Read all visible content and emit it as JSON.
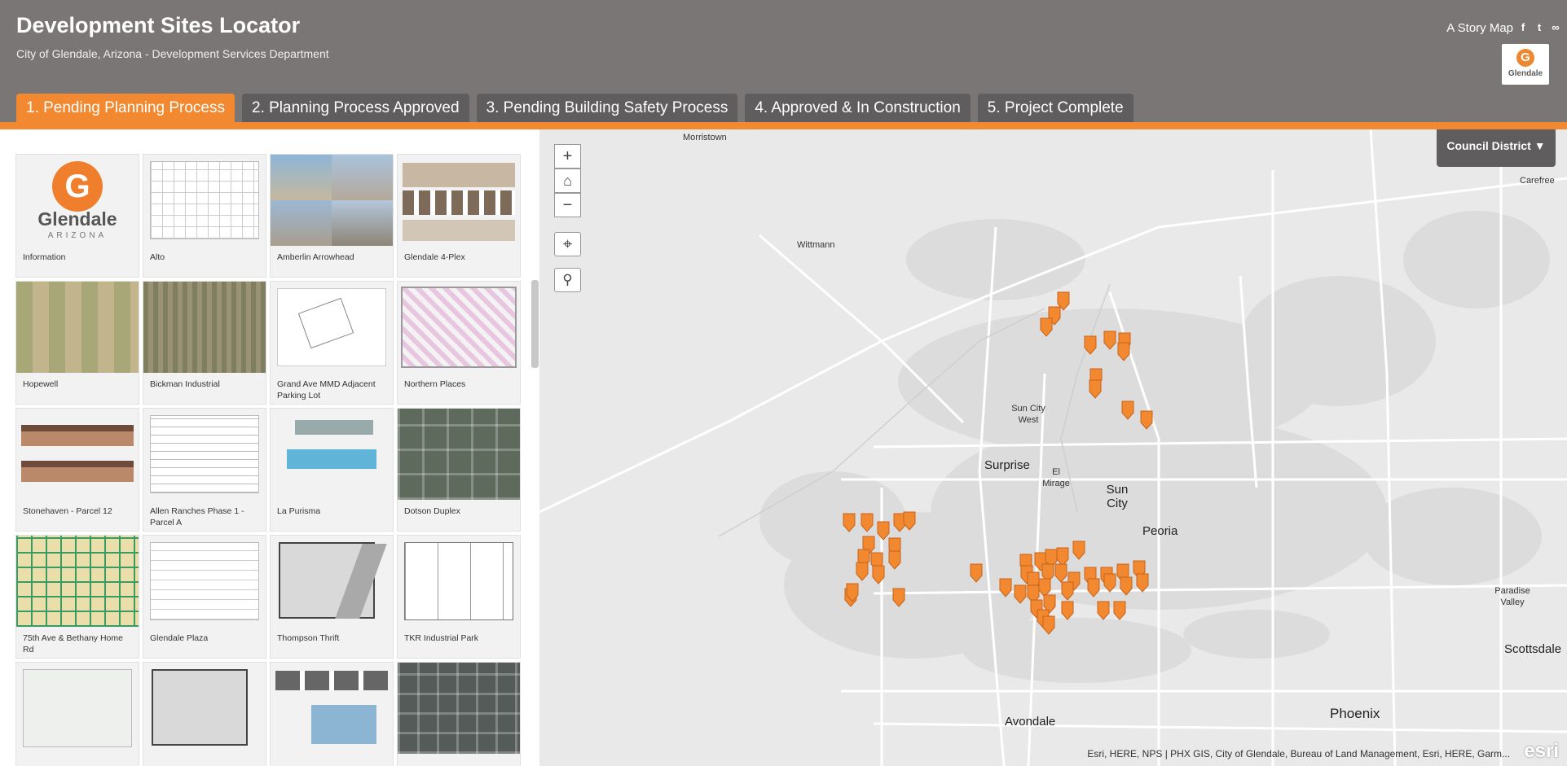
{
  "header": {
    "title": "Development Sites Locator",
    "subtitle": "City of Glendale, Arizona - Development Services Department",
    "story_map": "A Story Map",
    "logo_text": "Glendale",
    "logo_letter": "G"
  },
  "tabs": [
    {
      "label": "1. Pending Planning Process",
      "active": true
    },
    {
      "label": "2. Planning Process Approved"
    },
    {
      "label": "3. Pending Building Safety Process"
    },
    {
      "label": "4. Approved & In Construction"
    },
    {
      "label": "5. Project Complete"
    }
  ],
  "cards": [
    "Information",
    "Alto",
    "Amberlin Arrowhead",
    "Glendale 4-Plex",
    "Hopewell",
    "Bickman Industrial",
    "Grand Ave MMD Adjacent Parking Lot",
    "Northern Places",
    "Stonehaven - Parcel 12",
    "Allen Ranches Phase 1 - Parcel A",
    "La Purisma",
    "Dotson Duplex",
    "75th Ave & Bethany Home Rd",
    "Glendale Plaza",
    "Thompson Thrift",
    "TKR Industrial Park",
    "",
    "",
    "",
    ""
  ],
  "info_logo": {
    "name": "Glendale",
    "sub": "ARIZONA"
  },
  "map": {
    "dropdown": "Council District ▼",
    "zoom_in": "+",
    "zoom_out": "−",
    "home_icon": "⌂",
    "locate_icon": "⌖",
    "search_icon": "⚲",
    "places": [
      "Morristown",
      "Wittmann",
      "Carefree",
      "Sun City West",
      "Surprise",
      "El Mirage",
      "Sun City",
      "Peoria",
      "Paradise Valley",
      "Scottsdale",
      "Avondale",
      "Phoenix"
    ],
    "attribution": "Esri, HERE, NPS | PHX GIS, City of Glendale, Bureau of Land Management, Esri, HERE, Garm...",
    "esri": "esri",
    "accent": "#f28830"
  }
}
